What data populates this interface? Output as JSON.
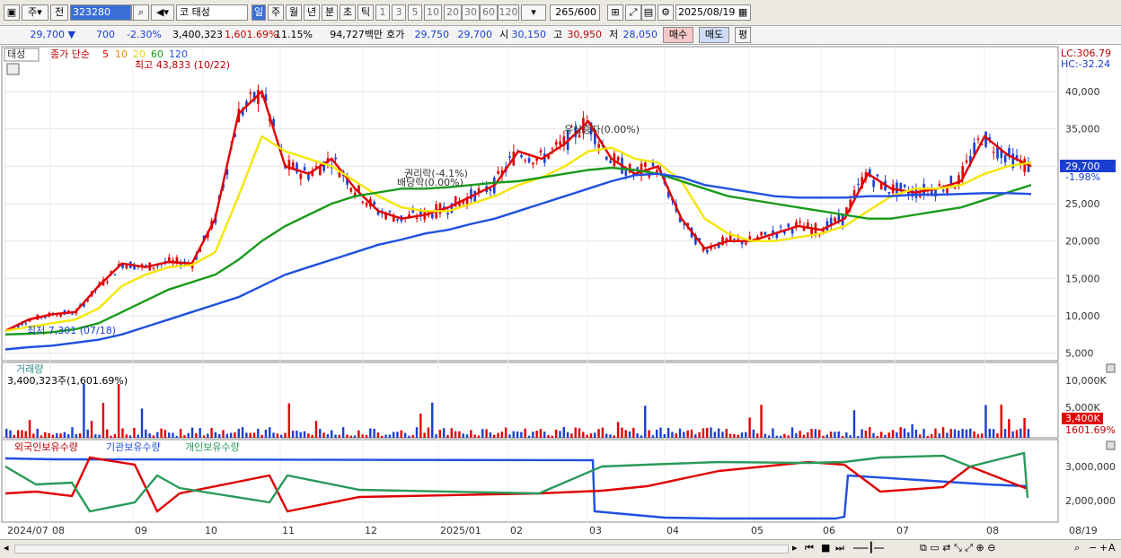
{
  "toolbar": {
    "market": "주",
    "prev": "전",
    "code": "323280",
    "stock_prefix": "코",
    "stock_name": "태성",
    "periods": [
      "일",
      "주",
      "월",
      "년",
      "분",
      "초",
      "틱"
    ],
    "selected_period": "일",
    "intervals": [
      "1",
      "3",
      "5",
      "10",
      "20",
      "30",
      "60",
      "120"
    ],
    "count": "265",
    "count_total": "/600",
    "date": "2025/08/19"
  },
  "quote": {
    "price": "29,700",
    "arrow": "▼",
    "change": "700",
    "change_pct": "-2.30%",
    "volume": "3,400,323",
    "volume_pct": "1,601.69%",
    "turnover_pct": "11.15%",
    "amount": "94,727백만",
    "hoga_label": "호가",
    "hoga1": "29,750",
    "hoga2": "29,700",
    "open_label": "시",
    "open": "30,150",
    "high_label": "고",
    "high": "30,950",
    "low_label": "저",
    "low": "28,050",
    "buy_label": "매수",
    "sell_label": "매도",
    "eval_label": "평"
  },
  "legend": {
    "name": "태성",
    "ma_label": "종가 단순",
    "ma_periods": [
      "5",
      "10",
      "20",
      "60",
      "120"
    ],
    "ma_colors": [
      "#e00000",
      "#f08c00",
      "#f5e600",
      "#1a9a1a",
      "#2050e0"
    ]
  },
  "annotations": {
    "high": "최고 43,833 (10/22)",
    "low": "최저 7,301 (07/18)",
    "right1": "권리락(-4.1%)",
    "right2": "배당락(0.00%)",
    "paid_in": "유상증자(0.00%)"
  },
  "axis_right": {
    "lc": "LC:306.79",
    "hc": "HC:-32.24",
    "price_ticks": [
      "40,000",
      "35,000",
      "30,000",
      "25,000",
      "20,000",
      "15,000",
      "10,000",
      "5,000"
    ],
    "current_price": "29,700",
    "current_pct": "-1.98%",
    "vol_ticks": [
      "10,000K",
      "5,000K",
      "0K"
    ],
    "vol_current": "3,400K",
    "vol_pct": "1601.69%",
    "hold_ticks": [
      "3,000,000",
      "2,000,000"
    ]
  },
  "volume_panel": {
    "title": "거래량",
    "value": "3,400,323주(1,601.69%)"
  },
  "holdings_panel": {
    "foreign": "외국인보유수량",
    "institution": "기관보유수량",
    "individual": "개인보유수량",
    "colors": {
      "foreign": "#e00000",
      "institution": "#2050e0",
      "individual": "#2a9a5a"
    }
  },
  "x_axis": [
    "2024/07",
    "08",
    "09",
    "10",
    "11",
    "12",
    "2025/01",
    "02",
    "03",
    "04",
    "05",
    "06",
    "07",
    "08",
    "08/19"
  ],
  "colors": {
    "up": "#e00000",
    "down": "#1a3fd0",
    "selected": "#3a6fd8"
  },
  "chart_data": {
    "type": "candlestick",
    "ylim": [
      4000,
      46000
    ],
    "series_ma": [
      {
        "name": "5",
        "values": [
          8000,
          9500,
          10200,
          10500,
          14000,
          17000,
          16500,
          17200,
          17000,
          23000,
          37000,
          40000,
          30000,
          29000,
          31000,
          27000,
          24000,
          23000,
          23500,
          24500,
          26000,
          27500,
          32000,
          31000,
          33000,
          36000,
          31000,
          29000,
          30000,
          23000,
          19000,
          20000,
          20000,
          21000,
          22000,
          21500,
          23000,
          29000,
          27000,
          26500,
          27000,
          28000,
          34000,
          31500,
          30000
        ]
      },
      {
        "name": "20",
        "values": [
          8000,
          8500,
          9000,
          9500,
          11000,
          14000,
          15500,
          16500,
          16800,
          18500,
          26000,
          34000,
          32000,
          31000,
          30000,
          28000,
          26000,
          24500,
          24000,
          24000,
          25000,
          26000,
          27500,
          28500,
          30000,
          32000,
          32500,
          31000,
          30500,
          28000,
          23000,
          21000,
          20000,
          20000,
          20500,
          21000,
          22000,
          24000,
          26000,
          27000,
          27000,
          27500,
          29000,
          30000,
          30500
        ]
      },
      {
        "name": "60",
        "values": [
          7500,
          7600,
          7800,
          8200,
          9000,
          10500,
          12000,
          13500,
          14500,
          15500,
          17500,
          20000,
          22000,
          23500,
          25000,
          26000,
          26500,
          27000,
          27000,
          27200,
          27500,
          27800,
          28000,
          28500,
          29000,
          29500,
          29800,
          29500,
          29000,
          28000,
          27000,
          26000,
          25500,
          25000,
          24500,
          24000,
          23500,
          23000,
          23000,
          23500,
          24000,
          24500,
          25500,
          26500,
          27500
        ]
      },
      {
        "name": "120",
        "values": [
          5500,
          5800,
          6000,
          6400,
          6800,
          7500,
          8500,
          9500,
          10500,
          11500,
          12500,
          14000,
          15500,
          16500,
          17500,
          18500,
          19500,
          20200,
          21000,
          21500,
          22300,
          23000,
          24000,
          25000,
          26000,
          27000,
          28000,
          28800,
          29000,
          28500,
          27500,
          27000,
          26500,
          26000,
          25800,
          25800,
          25800,
          26000,
          26000,
          26200,
          26200,
          26300,
          26400,
          26400,
          26300
        ]
      }
    ]
  }
}
